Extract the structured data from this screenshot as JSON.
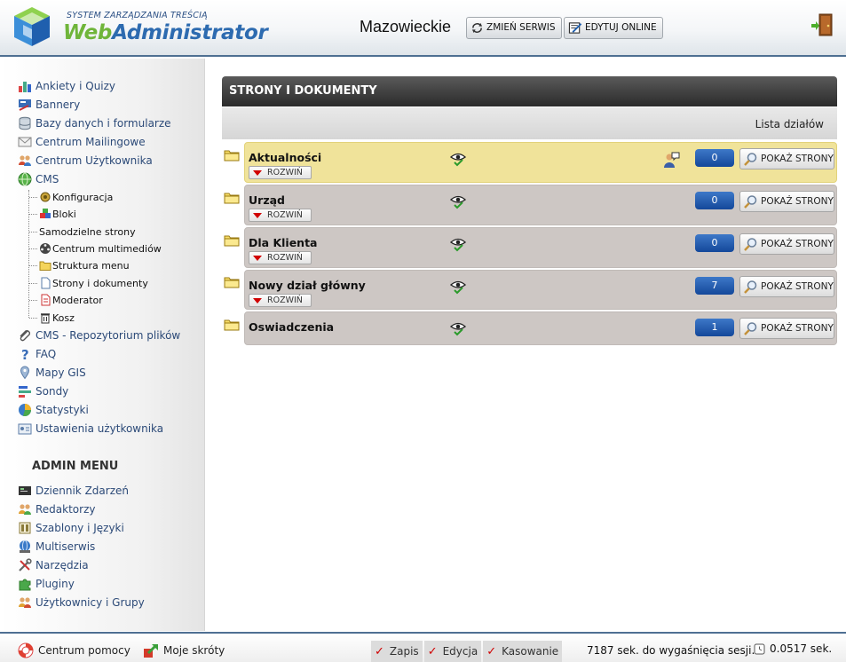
{
  "header": {
    "logo_small": "SYSTEM ZARZĄDZANIA TREŚCIĄ",
    "logo_web": "Web",
    "logo_admin": "Administrator",
    "site_name": "Mazowieckie",
    "change_service_label": "ZMIEŃ SERWIS",
    "edit_online_label": "EDYTUJ ONLINE"
  },
  "sidebar": {
    "items": [
      {
        "label": "Ankiety i Quizy",
        "icon": "bar-chart-icon"
      },
      {
        "label": "Bannery",
        "icon": "banner-icon"
      },
      {
        "label": "Bazy danych i formularze",
        "icon": "database-icon"
      },
      {
        "label": "Centrum Mailingowe",
        "icon": "envelope-icon"
      },
      {
        "label": "Centrum Użytkownika",
        "icon": "users-icon"
      },
      {
        "label": "CMS",
        "icon": "globe-icon"
      }
    ],
    "cms_children": [
      {
        "label": "Konfiguracja",
        "icon": "config-icon"
      },
      {
        "label": "Bloki",
        "icon": "blocks-icon"
      },
      {
        "label": "Samodzielne strony",
        "icon": ""
      },
      {
        "label": "Centrum multimediów",
        "icon": "film-reel-icon"
      },
      {
        "label": "Struktura menu",
        "icon": "folder-icon"
      },
      {
        "label": "Strony i dokumenty",
        "icon": "document-icon"
      },
      {
        "label": "Moderator",
        "icon": "moderator-icon"
      },
      {
        "label": "Kosz",
        "icon": "trash-icon"
      }
    ],
    "items_after": [
      {
        "label": "CMS - Repozytorium plików",
        "icon": "paperclip-icon"
      },
      {
        "label": "FAQ",
        "icon": "question-icon"
      },
      {
        "label": "Mapy GIS",
        "icon": "map-pin-icon"
      },
      {
        "label": "Sondy",
        "icon": "poll-icon"
      },
      {
        "label": "Statystyki",
        "icon": "pie-chart-icon"
      },
      {
        "label": "Ustawienia użytkownika",
        "icon": "settings-card-icon"
      }
    ],
    "admin_title": "ADMIN MENU",
    "admin_items": [
      {
        "label": "Dziennik Zdarzeń",
        "icon": "log-icon"
      },
      {
        "label": "Redaktorzy",
        "icon": "editors-icon"
      },
      {
        "label": "Szablony i Języki",
        "icon": "template-icon"
      },
      {
        "label": "Multiserwis",
        "icon": "multiservice-icon"
      },
      {
        "label": "Narzędzia",
        "icon": "tools-icon"
      },
      {
        "label": "Pluginy",
        "icon": "puzzle-icon"
      },
      {
        "label": "Użytkownicy i Grupy",
        "icon": "group-icon"
      }
    ]
  },
  "main": {
    "panel_title": "STRONY I DOKUMENTY",
    "subheader": "Lista działów",
    "expand_label": "ROZWIŃ",
    "show_pages_label": "POKAŻ STRONY",
    "sections": [
      {
        "title": "Aktualności",
        "count": "0",
        "active": true,
        "expandable": true,
        "moderator": true
      },
      {
        "title": "Urząd",
        "count": "0",
        "active": false,
        "expandable": true,
        "moderator": false
      },
      {
        "title": "Dla Klienta",
        "count": "0",
        "active": false,
        "expandable": true,
        "moderator": false
      },
      {
        "title": "Nowy dział główny",
        "count": "7",
        "active": false,
        "expandable": true,
        "moderator": false
      },
      {
        "title": "Oswiadczenia",
        "count": "1",
        "active": false,
        "expandable": false,
        "moderator": false
      }
    ]
  },
  "footer": {
    "help_label": "Centrum pomocy",
    "shortcuts_label": "Moje skróty",
    "permissions": [
      "Zapis",
      "Edycja",
      "Kasowanie"
    ],
    "session_text": "7187 sek. do wygaśnięcia sesji.",
    "render_time": "0.0517 sek."
  },
  "colors": {
    "accent_blue": "#2d6bb0",
    "logo_green": "#6fb53a",
    "active_row": "#f0e39a",
    "row_bg": "#cdc7c4",
    "badge_blue": "#1d56a8"
  }
}
